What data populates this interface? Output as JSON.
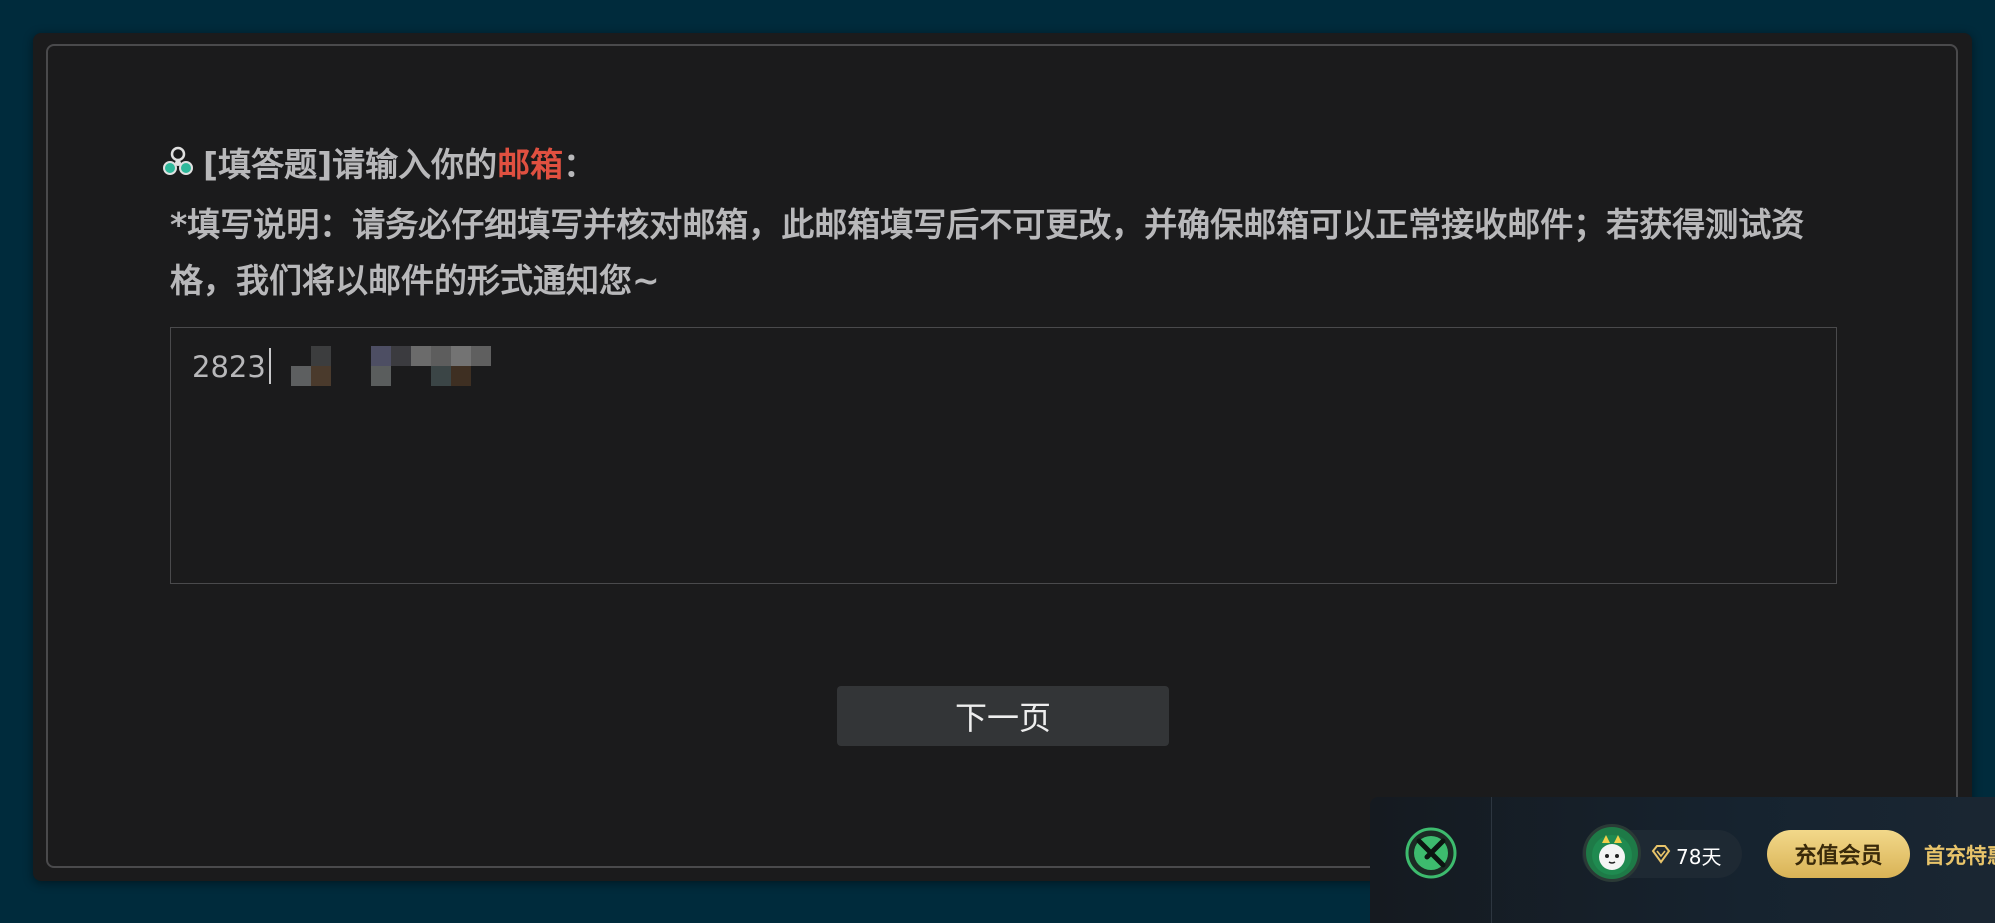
{
  "question": {
    "tag": "[填答题]",
    "prompt_before": " 请输入你的",
    "prompt_highlight": "邮箱",
    "prompt_after": "：",
    "instructions": "*填写说明：请务必仔细填写并核对邮箱，此邮箱填写后不可更改，并确保邮箱可以正常接收邮件；若获得测试资格，我们将以邮件的形式通知您~"
  },
  "answer": {
    "visible_value": "2823"
  },
  "navigation": {
    "next_label": "下一页"
  },
  "float_bar": {
    "days_label": "78天",
    "recharge_label": "充值会员",
    "promo_label": "首充特惠"
  },
  "colors": {
    "background": "#002b3c",
    "card": "#1b1b1c",
    "highlight": "#e05040",
    "gold": "#e8c46a"
  },
  "icons": {
    "question": "question-type-icon",
    "logo": "app-logo-icon",
    "diamond": "diamond-icon",
    "avatar": "avatar"
  }
}
